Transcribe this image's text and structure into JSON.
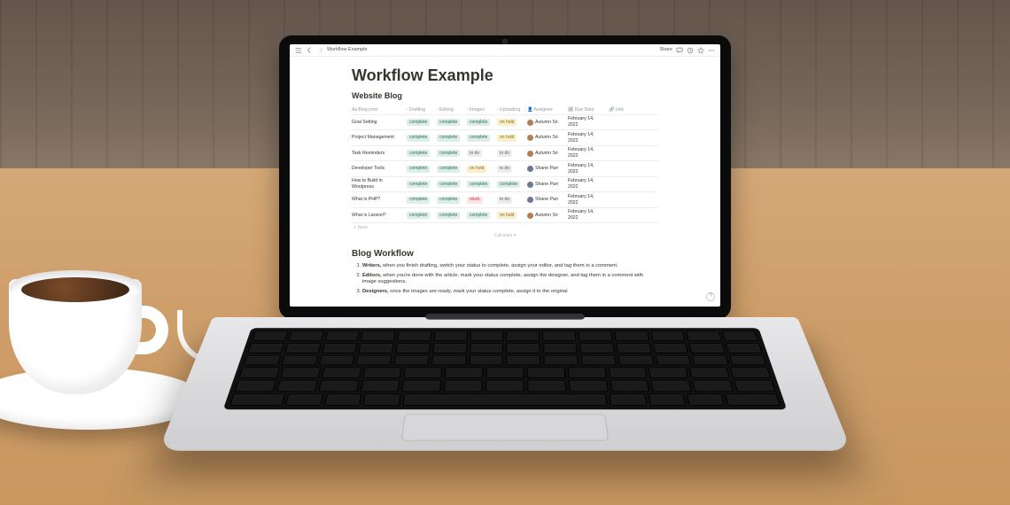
{
  "topbar": {
    "breadcrumb": "Workflow Example",
    "share_label": "Share"
  },
  "page": {
    "title": "Workflow Example",
    "db_title": "Website Blog",
    "columns": [
      "Blog post",
      "Drafting",
      "Editing",
      "Images",
      "Uploading",
      "Assignee",
      "Due Date",
      "Link"
    ],
    "rows": [
      {
        "post": "Goal Setting",
        "drafting": "complete",
        "editing": "complete",
        "images": "complete",
        "uploading": "on hold",
        "assignee": "Autumn Sn",
        "avatar": "a",
        "due": "February 14, 2022"
      },
      {
        "post": "Project Management",
        "drafting": "complete",
        "editing": "complete",
        "images": "complete",
        "uploading": "on hold",
        "assignee": "Autumn Sn",
        "avatar": "a",
        "due": "February 14, 2022"
      },
      {
        "post": "Task Reminders",
        "drafting": "complete",
        "editing": "complete",
        "images": "to do",
        "uploading": "to do",
        "assignee": "Autumn Sn",
        "avatar": "a",
        "due": "February 14, 2022"
      },
      {
        "post": "Developer Tools",
        "drafting": "complete",
        "editing": "complete",
        "images": "on hold",
        "uploading": "to do",
        "assignee": "Shane Parr",
        "avatar": "b",
        "due": "February 14, 2022"
      },
      {
        "post": "How to Build in Wordpress",
        "drafting": "complete",
        "editing": "complete",
        "images": "complete",
        "uploading": "complete",
        "assignee": "Shane Parr",
        "avatar": "b",
        "due": "February 14, 2022"
      },
      {
        "post": "What is PHP?",
        "drafting": "complete",
        "editing": "complete",
        "images": "stuck",
        "uploading": "to do",
        "assignee": "Shane Parr",
        "avatar": "b",
        "due": "February 14, 2022"
      },
      {
        "post": "What is Laravel?",
        "drafting": "complete",
        "editing": "complete",
        "images": "complete",
        "uploading": "on hold",
        "assignee": "Autumn Sn",
        "avatar": "a",
        "due": "February 14, 2022"
      }
    ],
    "new_label": "+  New",
    "calculate_label": "Calculate ▾",
    "section2_title": "Blog Workflow",
    "steps": [
      {
        "role": "Writers,",
        "text": " when you finish drafting, switch your status to complete, assign your editor, and tag them in a comment."
      },
      {
        "role": "Editors,",
        "text": " when you're done with the article, mark your status complete, assign the designer, and tag them in a comment with image suggestions."
      },
      {
        "role": "Designers,",
        "text": " once the images are ready, mark your status complete, assign it to the original"
      }
    ]
  },
  "status_styles": {
    "complete": "p-green",
    "on hold": "p-yellow",
    "to do": "p-gray",
    "stuck": "p-red"
  }
}
